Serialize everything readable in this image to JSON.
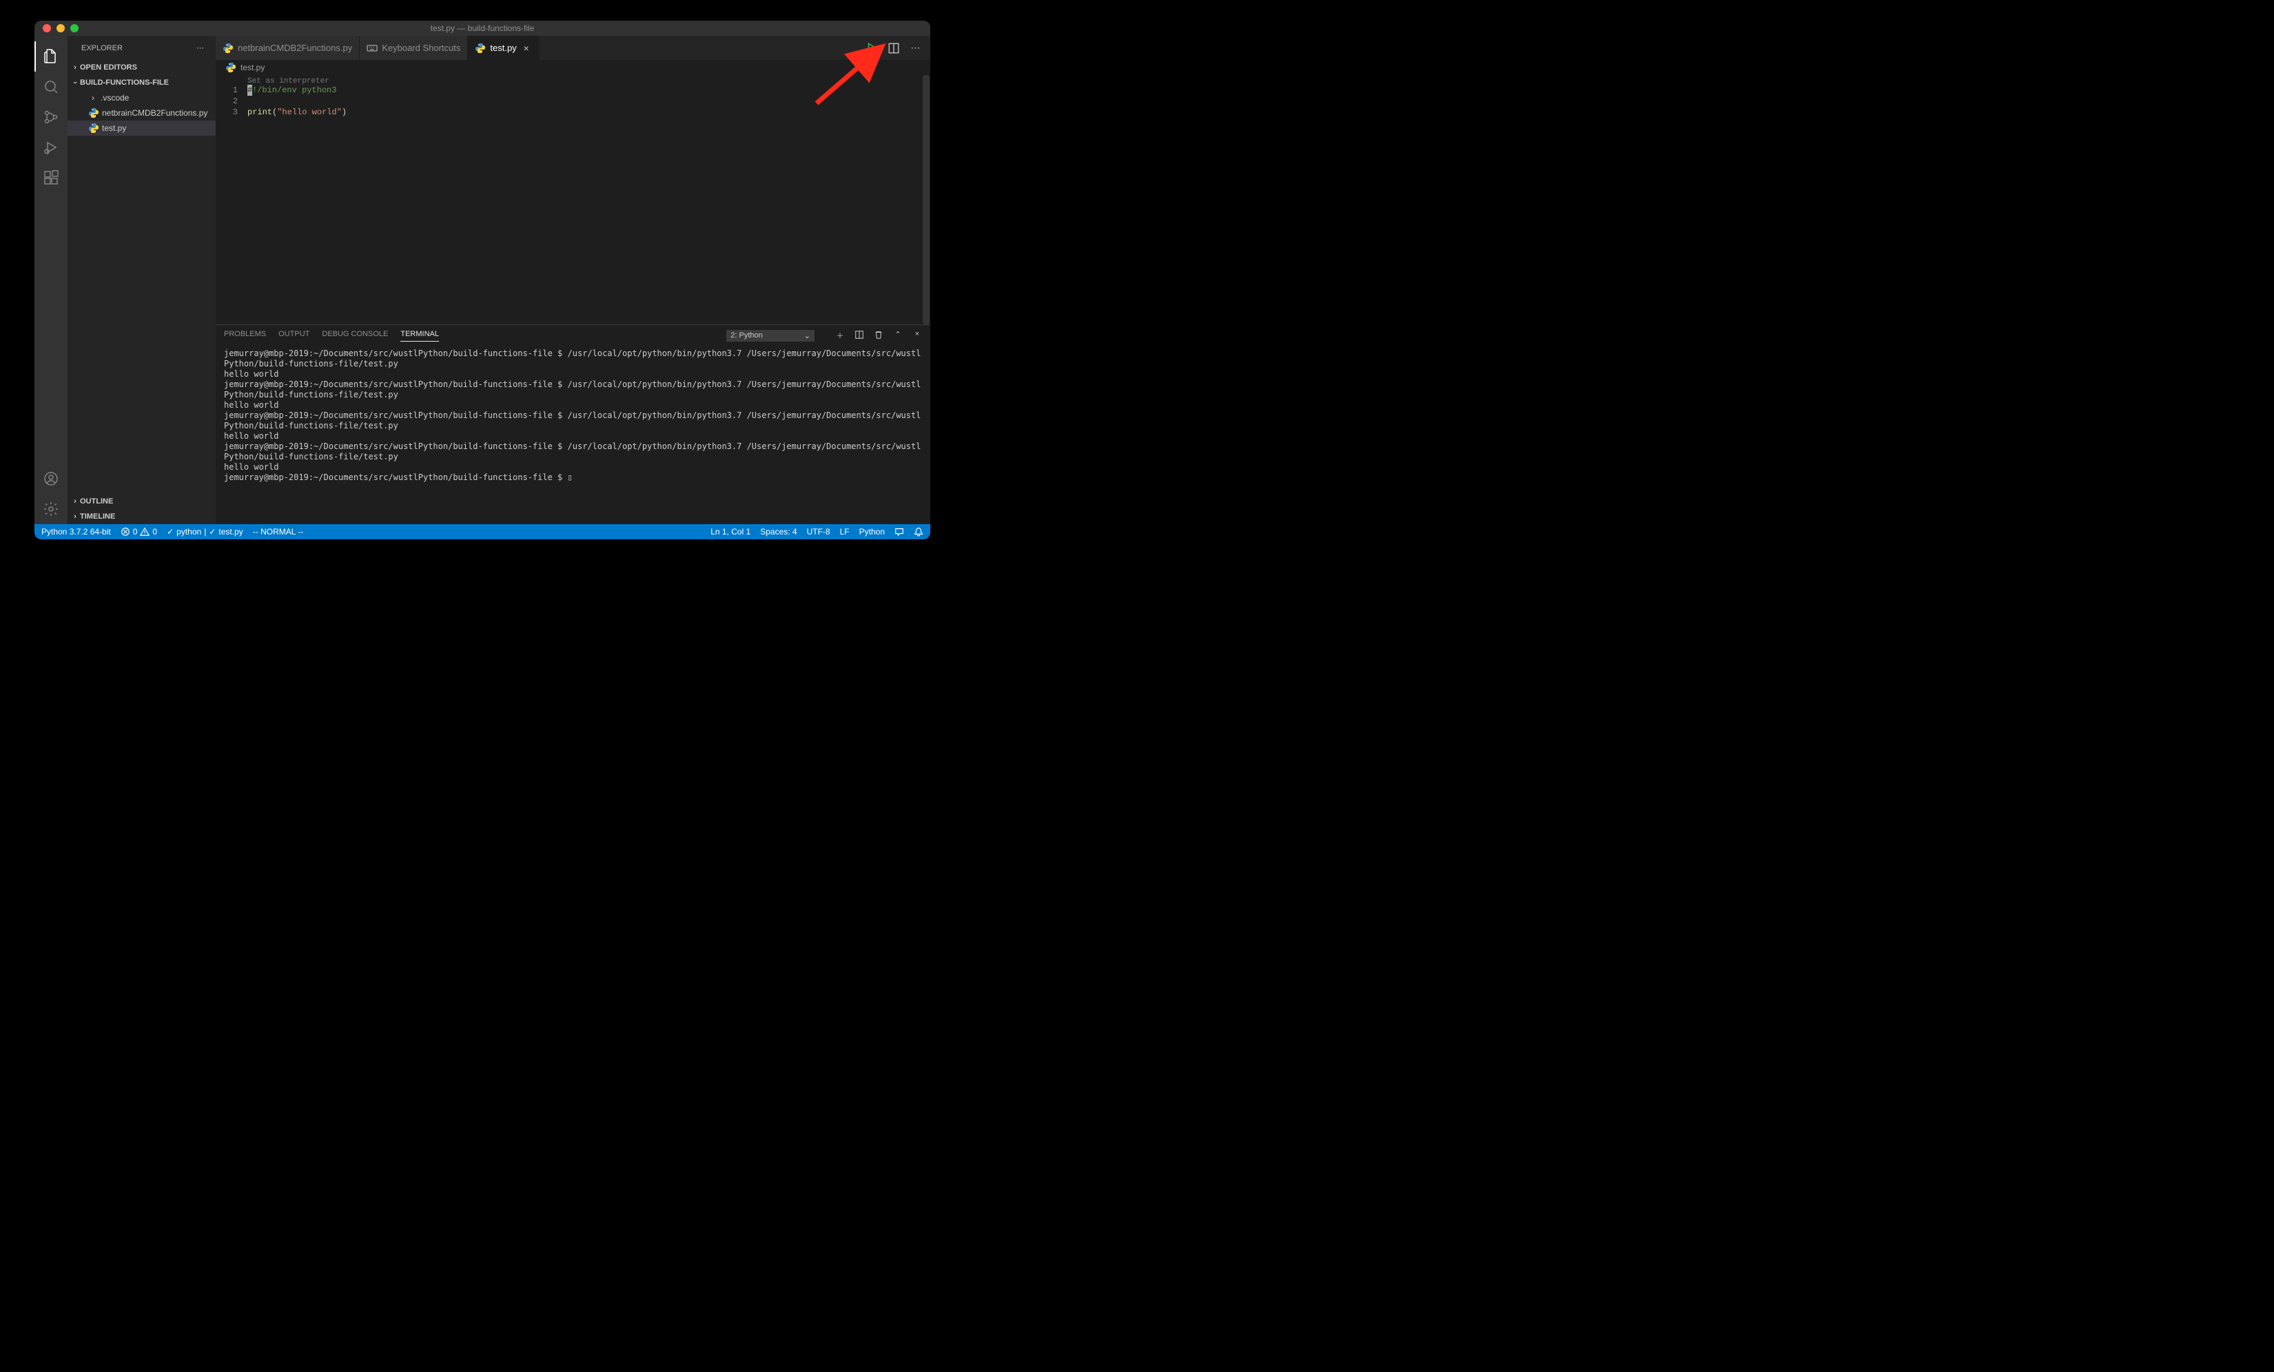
{
  "window_title": "test.py — build-functions-file",
  "sidebar": {
    "title": "EXPLORER",
    "open_editors": "OPEN EDITORS",
    "project": "BUILD-FUNCTIONS-FILE",
    "items": [
      {
        "label": ".vscode",
        "type": "folder"
      },
      {
        "label": "netbrainCMDB2Functions.py",
        "type": "py"
      },
      {
        "label": "test.py",
        "type": "py",
        "selected": true
      }
    ],
    "outline": "OUTLINE",
    "timeline": "TIMELINE"
  },
  "tabs": [
    {
      "label": "netbrainCMDB2Functions.py",
      "type": "py",
      "active": false
    },
    {
      "label": "Keyboard Shortcuts",
      "type": "kb",
      "active": false
    },
    {
      "label": "test.py",
      "type": "py",
      "active": true
    }
  ],
  "breadcrumb": "test.py",
  "editor": {
    "hint": "Set as interpreter",
    "lines": [
      {
        "num": "1",
        "cursor": "#",
        "rest": "!/bin/env python3"
      },
      {
        "num": "2"
      },
      {
        "num": "3",
        "builtin": "print",
        "paren_open": "(",
        "string": "\"hello world\"",
        "paren_close": ")"
      }
    ]
  },
  "panel": {
    "tabs": {
      "problems": "PROBLEMS",
      "output": "OUTPUT",
      "debug": "DEBUG CONSOLE",
      "terminal": "TERMINAL"
    },
    "select": "2: Python",
    "lines": [
      "jemurray@mbp-2019:~/Documents/src/wustlPython/build-functions-file $ /usr/local/opt/python/bin/python3.7 /Users/jemurray/Documents/src/wustlPython/build-functions-file/test.py",
      "hello world",
      "jemurray@mbp-2019:~/Documents/src/wustlPython/build-functions-file $ /usr/local/opt/python/bin/python3.7 /Users/jemurray/Documents/src/wustlPython/build-functions-file/test.py",
      "hello world",
      "jemurray@mbp-2019:~/Documents/src/wustlPython/build-functions-file $ /usr/local/opt/python/bin/python3.7 /Users/jemurray/Documents/src/wustlPython/build-functions-file/test.py",
      "hello world",
      "jemurray@mbp-2019:~/Documents/src/wustlPython/build-functions-file $ /usr/local/opt/python/bin/python3.7 /Users/jemurray/Documents/src/wustlPython/build-functions-file/test.py",
      "hello world",
      "jemurray@mbp-2019:~/Documents/src/wustlPython/build-functions-file $ ▯"
    ]
  },
  "statusbar": {
    "python": "Python 3.7.2 64-bit",
    "errors": "0",
    "warnings": "0",
    "check1": "python",
    "check2": "test.py",
    "mode": "-- NORMAL --",
    "lncol": "Ln 1, Col 1",
    "spaces": "Spaces: 4",
    "encoding": "UTF-8",
    "eol": "LF",
    "lang": "Python"
  }
}
